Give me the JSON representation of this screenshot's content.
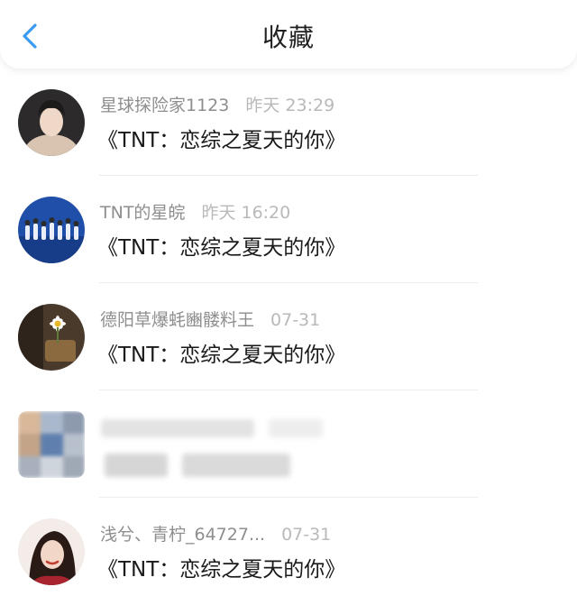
{
  "header": {
    "title": "收藏",
    "back_icon": "chevron-left-icon",
    "accent_color": "#3a9cf0"
  },
  "favorites": [
    {
      "username": "星球探险家1123",
      "time": "昨天 23:29",
      "content": "《TNT：恋综之夏天的你》"
    },
    {
      "username": "TNT的星皖",
      "time": "昨天 16:20",
      "content": "《TNT：恋综之夏天的你》"
    },
    {
      "username": "德阳草爆蚝豳髅料王",
      "time": "07-31",
      "content": "《TNT：恋综之夏天的你》"
    },
    {
      "username": "",
      "time": "",
      "content": ""
    },
    {
      "username": "浅兮、青柠_64727...",
      "time": "07-31",
      "content": "《TNT：恋综之夏天的你》"
    }
  ]
}
